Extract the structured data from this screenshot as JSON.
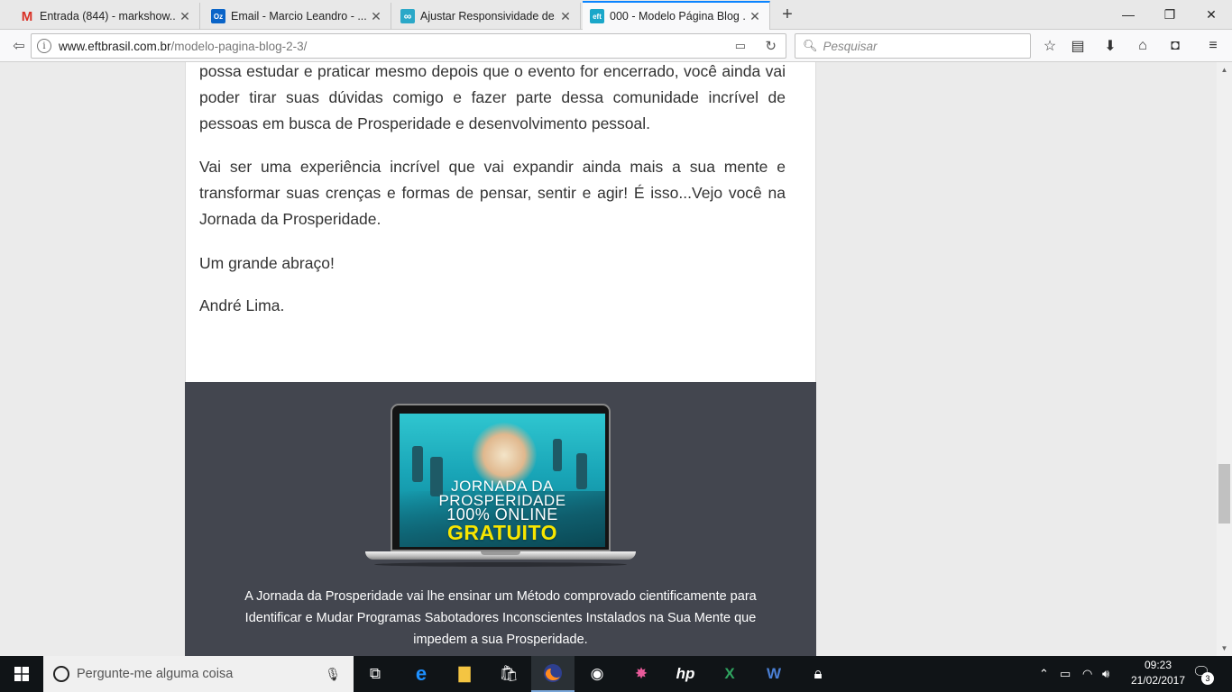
{
  "browser": {
    "tabs": [
      {
        "title": "Entrada (844) - markshow...",
        "icon": "gmail-icon",
        "color": "#d93025",
        "glyph": "M",
        "active": false
      },
      {
        "title": "Email - Marcio Leandro - ...",
        "icon": "outlook-icon",
        "color": "#0a64c8",
        "glyph": "Oz",
        "active": false
      },
      {
        "title": "Ajustar Responsividade de...",
        "icon": "site-icon",
        "color": "#2ba8c8",
        "glyph": "∞",
        "active": false
      },
      {
        "title": "000 - Modelo Página Blog ...",
        "icon": "eft-icon",
        "color": "#1aa7c9",
        "glyph": "eft",
        "active": true
      }
    ],
    "new_tab": "+",
    "window_controls": {
      "minimize": "—",
      "restore": "❐",
      "close": "✕"
    },
    "url": {
      "host": "www.eftbrasil.com.br",
      "path": "/modelo-pagina-blog-2-3/"
    },
    "search_placeholder": "Pesquisar"
  },
  "article": {
    "paragraphs": [
      "possa estudar e praticar mesmo depois que o evento for encerrado, você ainda vai poder tirar suas dúvidas comigo e fazer parte dessa comunidade incrível de pessoas em busca de Prosperidade e desenvolvimento pessoal.",
      "Vai ser uma experiência incrível que vai expandir ainda mais a sua mente e transformar suas crenças e formas de pensar, sentir e agir! É isso...Vejo você na Jornada da Prosperidade.",
      "Um grande abraço!",
      "André Lima."
    ]
  },
  "promo": {
    "screen_line1": "JORNADA DA",
    "screen_line2": "PROSPERIDADE",
    "screen_line3": "100% ONLINE",
    "screen_line4": "GRATUITO",
    "highlight_color": "#f7e600",
    "text": "A Jornada da Prosperidade vai lhe ensinar um Método comprovado cientificamente para Identificar e Mudar Programas Sabotadores Inconscientes Instalados na Sua Mente que impedem a sua Prosperidade."
  },
  "taskbar": {
    "cortana_placeholder": "Pergunte-me alguma coisa",
    "time": "09:23",
    "date": "21/02/2017",
    "notification_count": "3"
  }
}
